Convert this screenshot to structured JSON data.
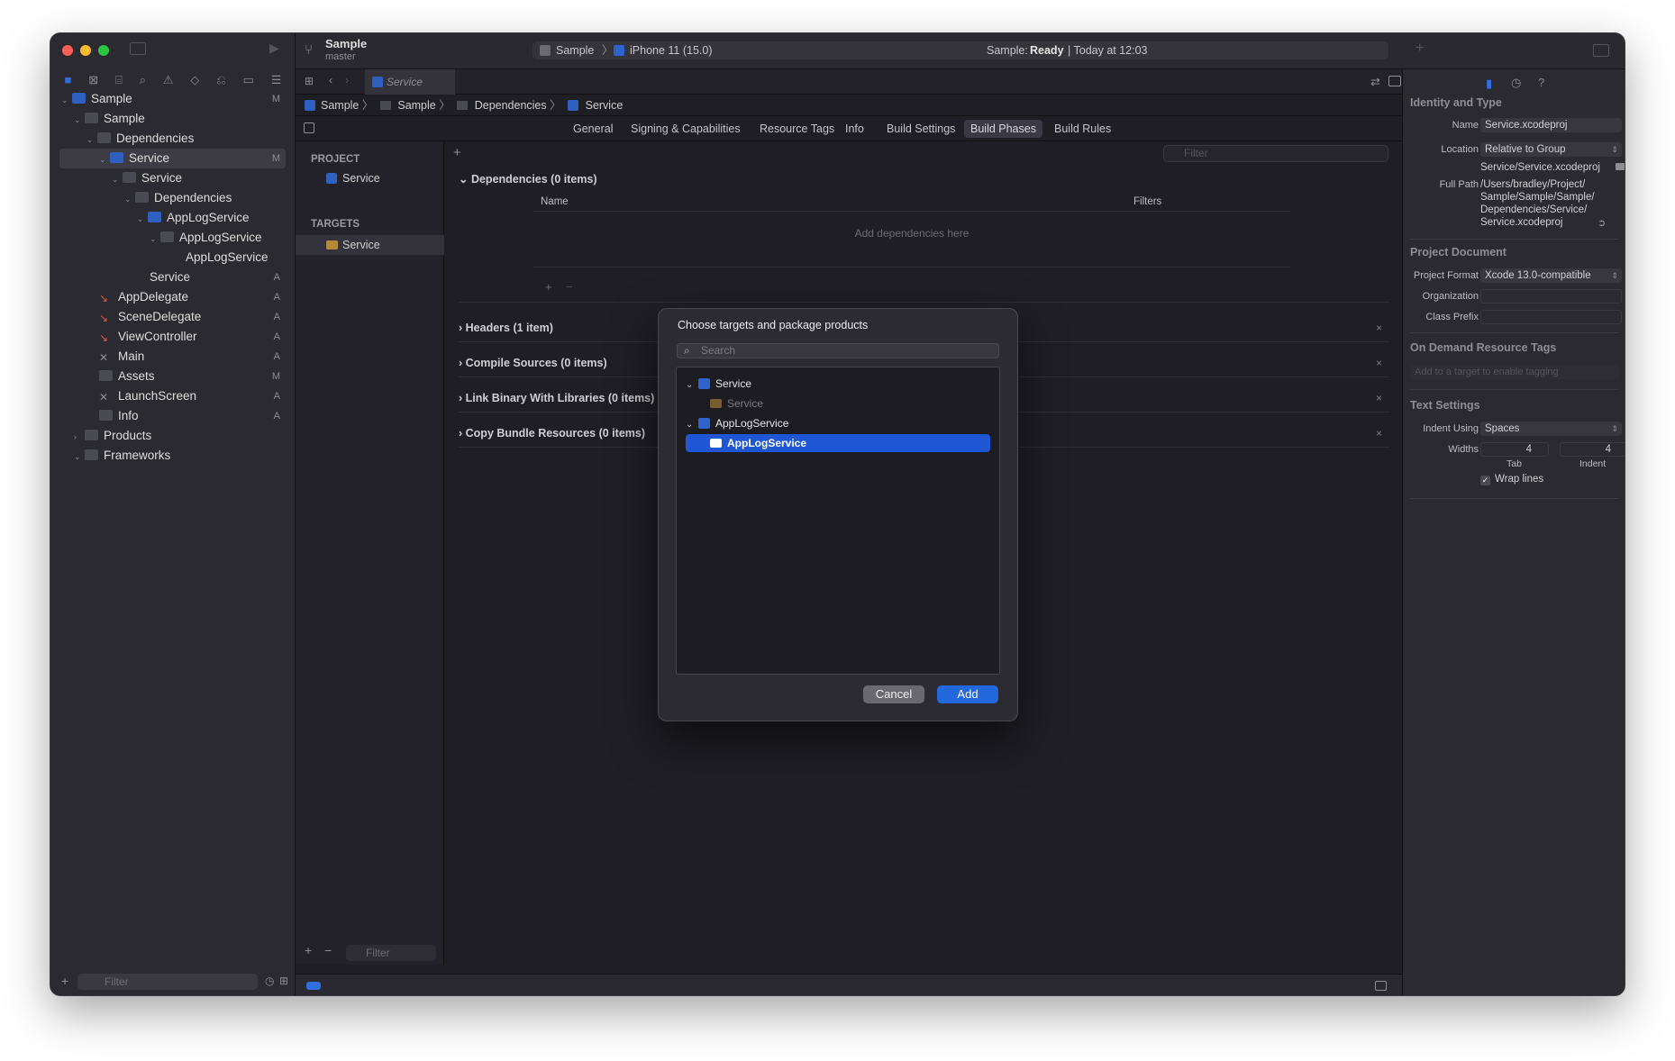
{
  "toolbar": {
    "scheme_name": "Sample",
    "branch": "master",
    "run_destination_scheme": "Sample",
    "run_destination_device": "iPhone 11 (15.0)",
    "status_prefix": "Sample:",
    "status_state": "Ready",
    "status_time": "| Today at 12:03"
  },
  "navigator": {
    "items": [
      {
        "label": "Sample",
        "badge": "M"
      },
      {
        "label": "Sample",
        "badge": ""
      },
      {
        "label": "Dependencies",
        "badge": ""
      },
      {
        "label": "Service",
        "badge": "M"
      },
      {
        "label": "Service",
        "badge": ""
      },
      {
        "label": "Dependencies",
        "badge": ""
      },
      {
        "label": "AppLogService",
        "badge": ""
      },
      {
        "label": "AppLogService",
        "badge": ""
      },
      {
        "label": "AppLogService",
        "badge": ""
      },
      {
        "label": "Service",
        "badge": "A"
      },
      {
        "label": "AppDelegate",
        "badge": "A"
      },
      {
        "label": "SceneDelegate",
        "badge": "A"
      },
      {
        "label": "ViewController",
        "badge": "A"
      },
      {
        "label": "Main",
        "badge": "A"
      },
      {
        "label": "Assets",
        "badge": "M"
      },
      {
        "label": "LaunchScreen",
        "badge": "A"
      },
      {
        "label": "Info",
        "badge": "A"
      },
      {
        "label": "Products",
        "badge": ""
      },
      {
        "label": "Frameworks",
        "badge": ""
      }
    ],
    "filter_placeholder": "Filter"
  },
  "editor": {
    "tab_label": "Service",
    "breadcrumb": [
      "Sample",
      "Sample",
      "Dependencies",
      "Service"
    ],
    "segments": [
      "General",
      "Signing & Capabilities",
      "Resource Tags",
      "Info",
      "Build Settings",
      "Build Phases",
      "Build Rules"
    ],
    "active_segment": "Build Phases",
    "project_header": "PROJECT",
    "project_item": "Service",
    "targets_header": "TARGETS",
    "target_item": "Service",
    "filter_placeholder": "Filter",
    "phases": {
      "dependencies_title": "Dependencies (0 items)",
      "col_name": "Name",
      "col_filters": "Filters",
      "empty_hint": "Add dependencies here",
      "headers": "Headers (1 item)",
      "compile": "Compile Sources (0 items)",
      "link": "Link Binary With Libraries (0 items)",
      "copy": "Copy Bundle Resources (0 items)"
    }
  },
  "inspector": {
    "identity_header": "Identity and Type",
    "name_label": "Name",
    "name_value": "Service.xcodeproj",
    "location_label": "Location",
    "location_value": "Relative to Group",
    "location_path": "Service/Service.xcodeproj",
    "fullpath_label": "Full Path",
    "fullpath_lines": [
      "/Users/bradley/Project/",
      "Sample/Sample/Sample/",
      "Dependencies/Service/",
      "Service.xcodeproj"
    ],
    "project_doc_header": "Project Document",
    "format_label": "Project Format",
    "format_value": "Xcode 13.0-compatible",
    "org_label": "Organization",
    "prefix_label": "Class Prefix",
    "odr_header": "On Demand Resource Tags",
    "odr_hint": "Add to a target to enable tagging",
    "text_header": "Text Settings",
    "indent_label": "Indent Using",
    "indent_value": "Spaces",
    "widths_label": "Widths",
    "tab_width": "4",
    "indent_width": "4",
    "tab_caption": "Tab",
    "indent_caption": "Indent",
    "wrap_label": "Wrap lines"
  },
  "modal": {
    "title": "Choose targets and package products",
    "search_placeholder": "Search",
    "rows": [
      {
        "label": "Service"
      },
      {
        "label": "Service"
      },
      {
        "label": "AppLogService"
      },
      {
        "label": "AppLogService"
      }
    ],
    "cancel_label": "Cancel",
    "add_label": "Add"
  }
}
